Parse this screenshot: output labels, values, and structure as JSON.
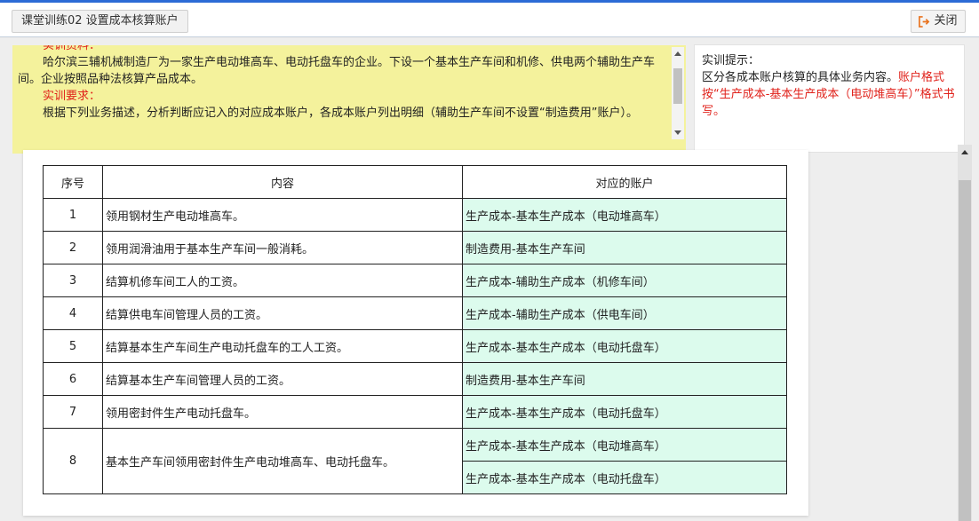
{
  "header": {
    "title": "课堂训练02 设置成本核算账户",
    "close_label": "关闭"
  },
  "material": {
    "heading1": "实训资料：",
    "text1": "哈尔滨三辅机械制造厂为一家生产电动堆高车、电动托盘车的企业。下设一个基本生产车间和机修、供电两个辅助生产车间。企业按照品种法核算产品成本。",
    "heading2": "实训要求：",
    "text2": "根据下列业务描述，分析判断应记入的对应成本账户，各成本账户列出明细（辅助生产车间不设置“制造费用”账户）。"
  },
  "hint": {
    "title": "实训提示：",
    "text": "区分各成本账户核算的具体业务内容。",
    "red_text": "账户格式按“生产成本-基本生产成本（电动堆高车）”格式书写。"
  },
  "table": {
    "headers": [
      "序号",
      "内容",
      "对应的账户"
    ],
    "rows": [
      {
        "num": "1",
        "content": "领用钢材生产电动堆高车。",
        "account": "生产成本-基本生产成本（电动堆高车）"
      },
      {
        "num": "2",
        "content": "领用润滑油用于基本生产车间一般消耗。",
        "account": "制造费用-基本生产车间"
      },
      {
        "num": "3",
        "content": "结算机修车间工人的工资。",
        "account": "生产成本-辅助生产成本（机修车间）"
      },
      {
        "num": "4",
        "content": "结算供电车间管理人员的工资。",
        "account": "生产成本-辅助生产成本（供电车间）"
      },
      {
        "num": "5",
        "content": "结算基本生产车间生产电动托盘车的工人工资。",
        "account": "生产成本-基本生产成本（电动托盘车）"
      },
      {
        "num": "6",
        "content": "结算基本生产车间管理人员的工资。",
        "account": "制造费用-基本生产车间"
      },
      {
        "num": "7",
        "content": "领用密封件生产电动托盘车。",
        "account": "生产成本-基本生产成本（电动托盘车）"
      },
      {
        "num": "8",
        "content": "基本生产车间领用密封件生产电动堆高车、电动托盘车。",
        "account": "生产成本-基本生产成本（电动堆高车）",
        "account2": "生产成本-基本生产成本（电动托盘车）"
      }
    ]
  }
}
